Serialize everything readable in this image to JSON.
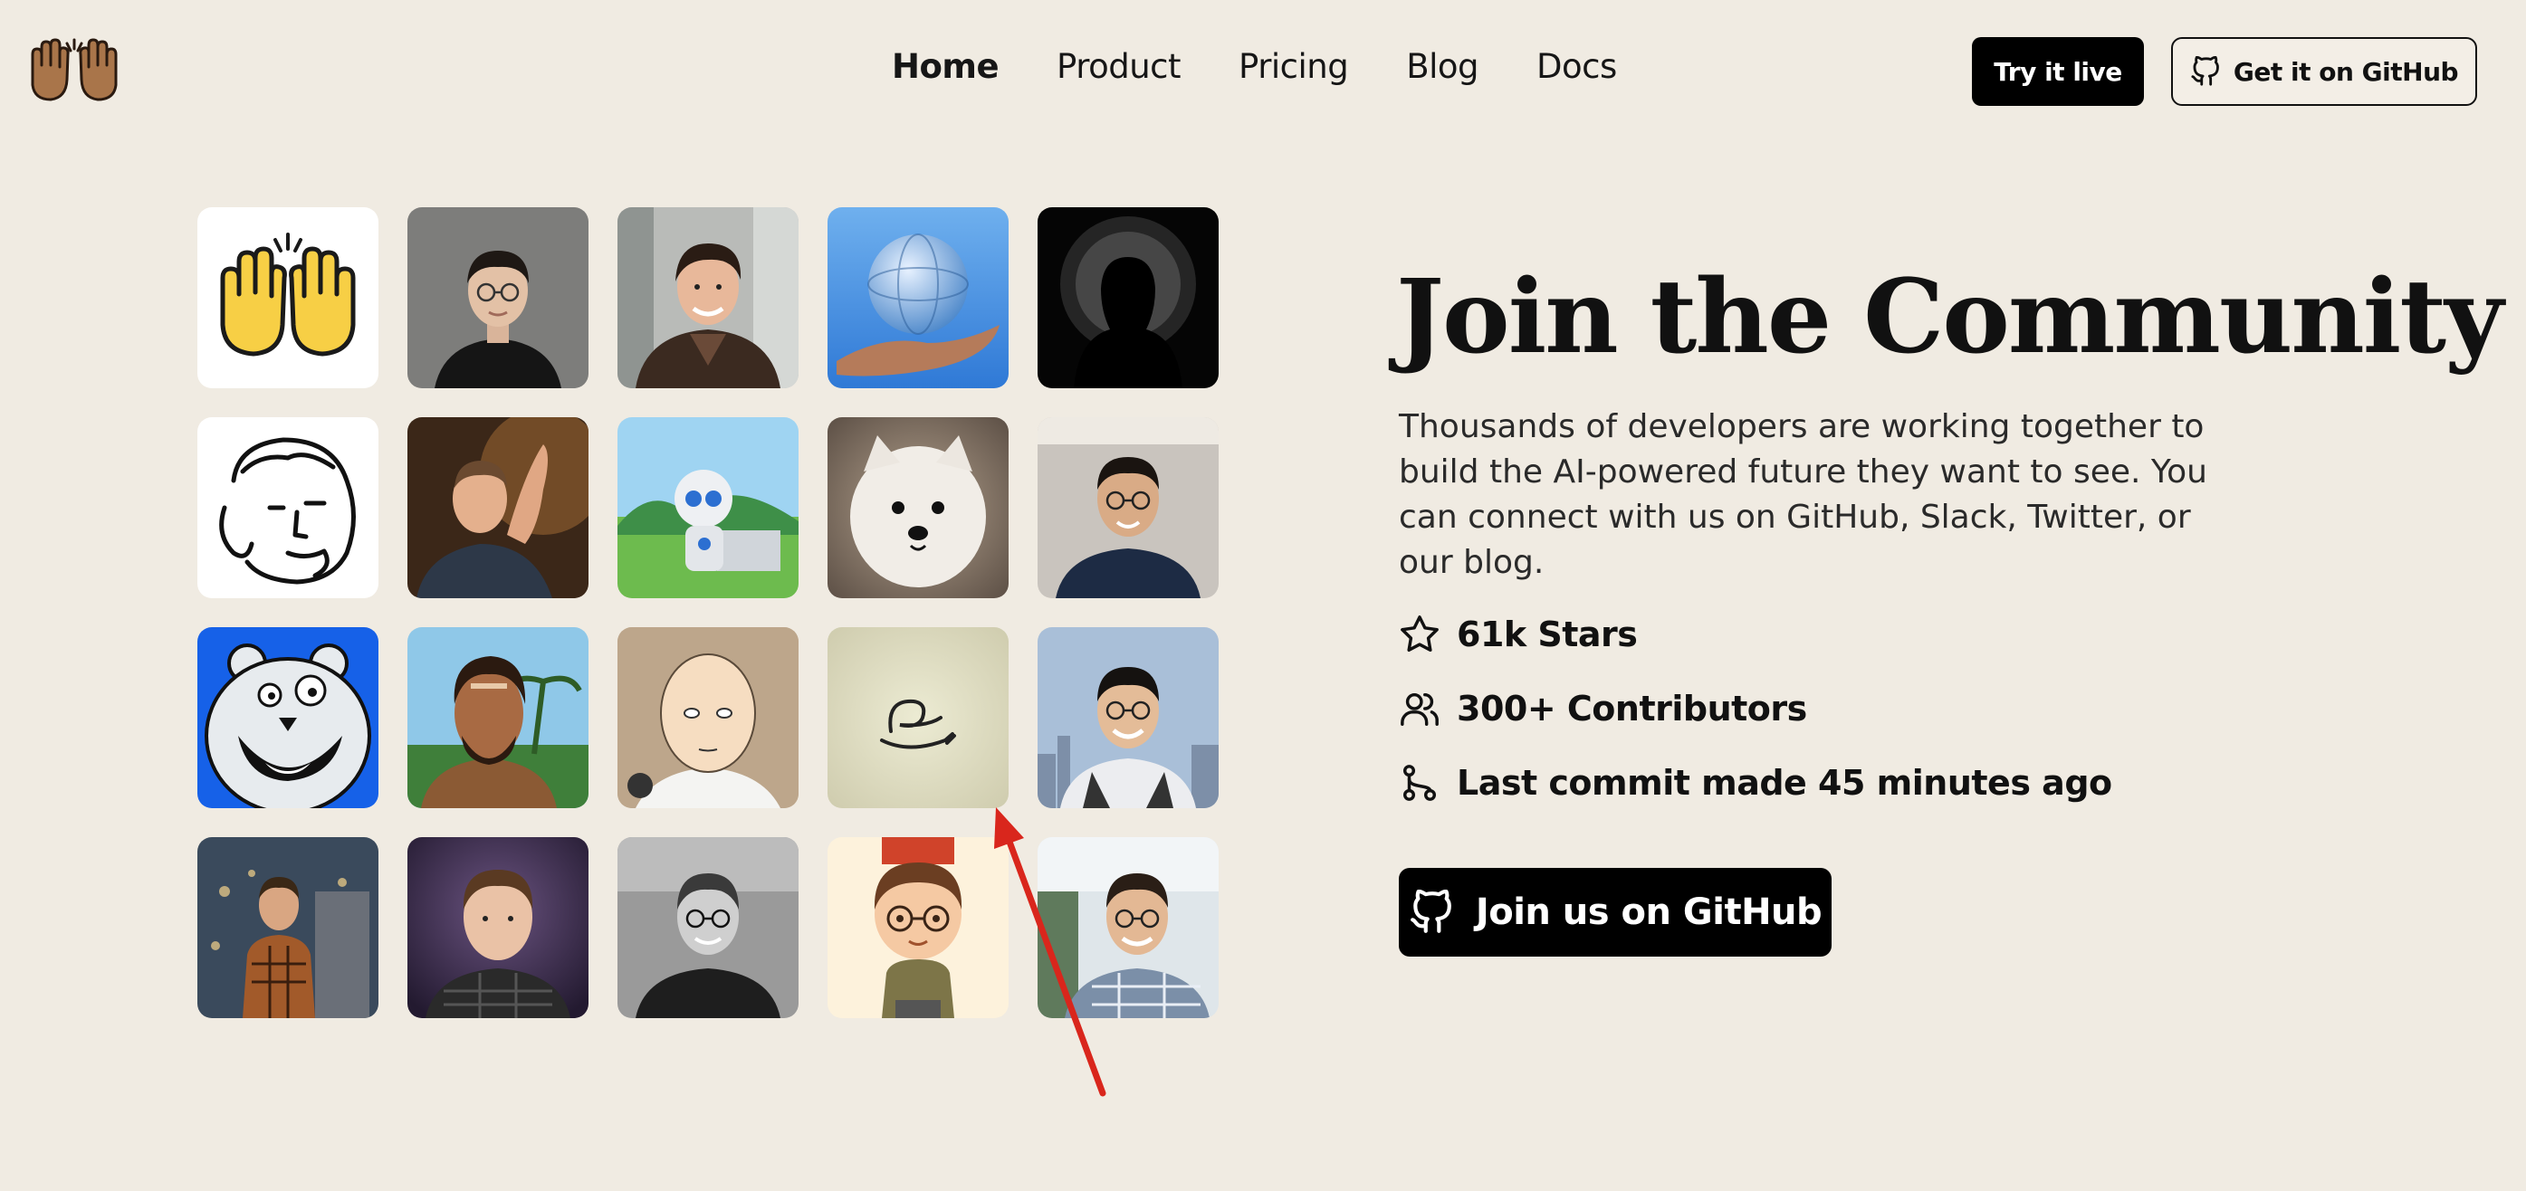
{
  "nav": {
    "items": [
      {
        "label": "Home",
        "active": true
      },
      {
        "label": "Product"
      },
      {
        "label": "Pricing"
      },
      {
        "label": "Blog"
      },
      {
        "label": "Docs"
      }
    ]
  },
  "header": {
    "logo_icon": "raised-hands-icon",
    "try_label": "Try it live",
    "github_label": "Get it on GitHub",
    "github_icon": "github-icon"
  },
  "community": {
    "title": "Join the Community",
    "description": "Thousands of developers are working together to build the AI-powered future they want to see. You can connect with us on GitHub, Slack, Twitter, or our blog.",
    "stats": [
      {
        "icon": "star-icon",
        "label": "61k Stars"
      },
      {
        "icon": "users-icon",
        "label": "300+ Contributors"
      },
      {
        "icon": "git-branch-icon",
        "label": "Last commit made 45 minutes ago"
      }
    ],
    "join_label": "Join us on GitHub",
    "join_icon": "github-icon"
  },
  "avatars": [
    {
      "name": "raised-hands-emoji"
    },
    {
      "name": "man-glasses-black-shirt"
    },
    {
      "name": "man-smiling-brown-jacket"
    },
    {
      "name": "globe-in-hand"
    },
    {
      "name": "silhouette-particles"
    },
    {
      "name": "line-drawing-face"
    },
    {
      "name": "man-pointing"
    },
    {
      "name": "robot-at-desk"
    },
    {
      "name": "white-dog"
    },
    {
      "name": "man-glasses-office"
    },
    {
      "name": "cartoon-bear"
    },
    {
      "name": "cartoon-bearded-man"
    },
    {
      "name": "anime-bald-hero"
    },
    {
      "name": "cursive-logo"
    },
    {
      "name": "man-glasses-city"
    },
    {
      "name": "man-plaid-night"
    },
    {
      "name": "man-purple-backdrop"
    },
    {
      "name": "man-black-white"
    },
    {
      "name": "cartoon-boy-glasses"
    },
    {
      "name": "man-glasses-park"
    }
  ],
  "colors": {
    "background": "#f0ebe2",
    "button_dark": "#000000",
    "annotation_arrow": "#d9261c"
  }
}
